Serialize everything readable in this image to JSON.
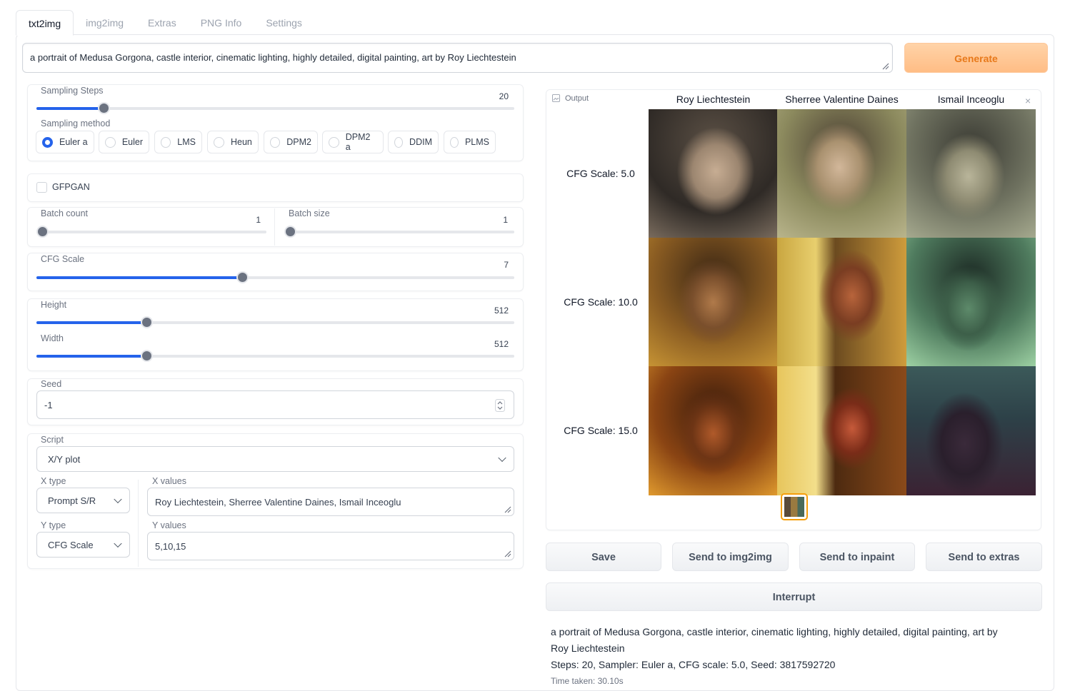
{
  "tabs": [
    "txt2img",
    "img2img",
    "Extras",
    "PNG Info",
    "Settings"
  ],
  "prompt": "a portrait of Medusa Gorgona, castle interior, cinematic lighting, highly detailed, digital painting, art by Roy Liechtestein",
  "generate_label": "Generate",
  "sampling_steps": {
    "label": "Sampling Steps",
    "value": "20",
    "fraction": 0.14
  },
  "sampling_method": {
    "label": "Sampling method",
    "options": [
      "Euler a",
      "Euler",
      "LMS",
      "Heun",
      "DPM2",
      "DPM2 a",
      "DDIM",
      "PLMS"
    ],
    "selected": "Euler a"
  },
  "gfpgan_label": "GFPGAN",
  "batch_count": {
    "label": "Batch count",
    "value": "1"
  },
  "batch_size": {
    "label": "Batch size",
    "value": "1"
  },
  "cfg_scale": {
    "label": "CFG Scale",
    "value": "7",
    "fraction": 0.43
  },
  "height": {
    "label": "Height",
    "value": "512",
    "fraction": 0.23
  },
  "width": {
    "label": "Width",
    "value": "512",
    "fraction": 0.23
  },
  "seed": {
    "label": "Seed",
    "value": "-1"
  },
  "script": {
    "label": "Script",
    "value": "X/Y plot"
  },
  "x_type": {
    "label": "X type",
    "value": "Prompt S/R"
  },
  "x_values": {
    "label": "X values",
    "value": "Roy Liechtestein, Sherree Valentine Daines, Ismail Inceoglu"
  },
  "y_type": {
    "label": "Y type",
    "value": "CFG Scale"
  },
  "y_values": {
    "label": "Y values",
    "value": "5,10,15"
  },
  "output": {
    "label": "Output",
    "columns": [
      "Roy Liechtestein",
      "Sherree Valentine Daines",
      "Ismail Inceoglu"
    ],
    "rows": [
      "CFG Scale: 5.0",
      "CFG Scale: 10.0",
      "CFG Scale: 15.0"
    ]
  },
  "buttons": {
    "save": "Save",
    "img2img": "Send to img2img",
    "inpaint": "Send to inpaint",
    "extras": "Send to extras",
    "interrupt": "Interrupt"
  },
  "info": {
    "line1": "a portrait of Medusa Gorgona, castle interior, cinematic lighting, highly detailed, digital painting, art by",
    "line2": "Roy Liechtestein",
    "line3": "Steps: 20, Sampler: Euler a, CFG scale: 5.0, Seed: 3817592720",
    "line4": "Time taken: 30.10s"
  },
  "colors": {
    "accent": "#2563eb",
    "generate_bg": "#ffc596",
    "generate_text": "#e8791a"
  }
}
